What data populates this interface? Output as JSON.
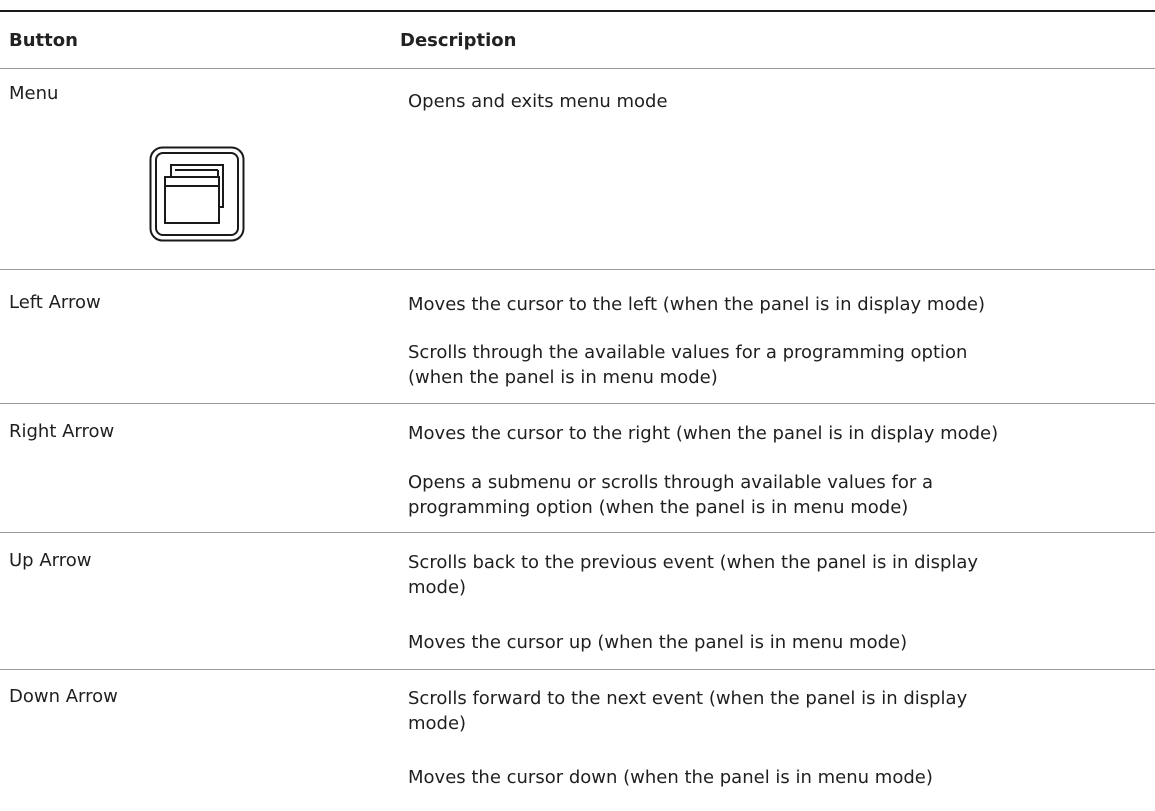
{
  "table": {
    "headers": {
      "button": "Button",
      "description": "Description"
    },
    "rows": [
      {
        "button": "Menu",
        "descriptions": [
          "Opens and exits menu mode"
        ],
        "icon": "menu-icon"
      },
      {
        "button": "Left Arrow",
        "descriptions": [
          "Moves the cursor to the left (when the panel is in display mode)",
          "Scrolls through the available values for a programming option (when the panel is in menu mode)"
        ]
      },
      {
        "button": "Right Arrow",
        "descriptions": [
          "Moves the cursor to the right (when the panel is in display mode)",
          "Opens a submenu or scrolls through available values for a programming option (when the panel is in menu mode)"
        ]
      },
      {
        "button": "Up Arrow",
        "descriptions": [
          "Scrolls back to the previous event (when the panel is in display mode)",
          "Moves the cursor up (when the panel is in menu mode)"
        ]
      },
      {
        "button": "Down Arrow",
        "descriptions": [
          "Scrolls forward to the next event (when the panel is in display mode)",
          "Moves the cursor down (when the panel is in menu mode)"
        ]
      }
    ]
  }
}
